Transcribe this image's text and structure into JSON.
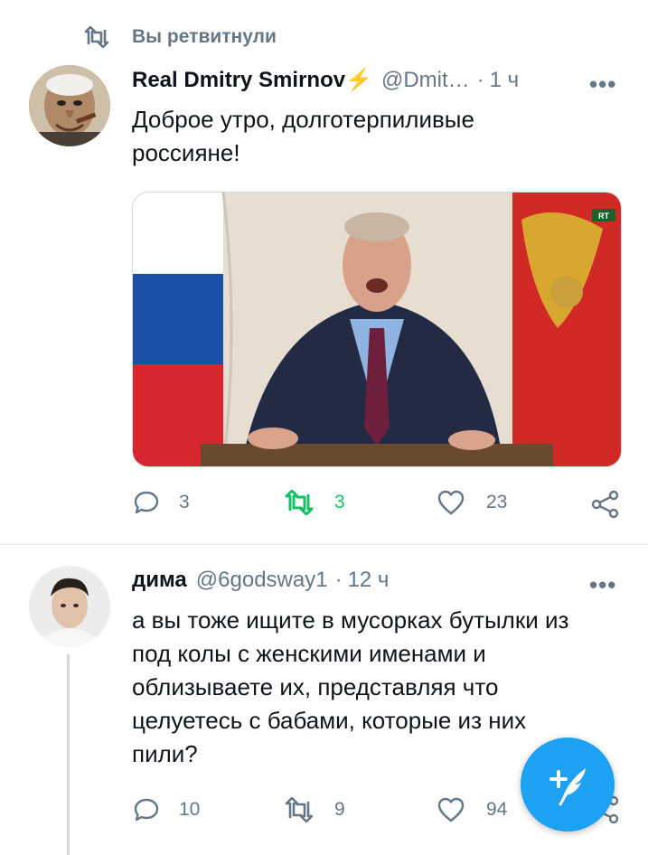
{
  "retweet_banner": {
    "label": "Вы ретвитнули"
  },
  "tweets": [
    {
      "author_name": "Real Dmitry Smirnov⚡",
      "handle": "@Dmit…",
      "separator": "·",
      "time": "1 ч",
      "text_lines": [
        "Доброе утро, долготерпиливые",
        "россияне!"
      ],
      "reply_count": "3",
      "retweet_count": "3",
      "like_count": "23",
      "media_badge": "RT",
      "retweeted": true
    },
    {
      "author_name": "дима",
      "handle": "@6godsway1",
      "separator": "·",
      "time": "12 ч",
      "text_lines": [
        "а вы тоже ищите в мусорках бутылки из",
        "под колы с женскими именами и",
        "облизываете их, представляя что",
        "целуетесь с бабами, которые из них",
        "пили?"
      ],
      "reply_count": "10",
      "retweet_count": "9",
      "like_count": "94",
      "retweeted": false
    }
  ],
  "more_label": "•••",
  "colors": {
    "accent": "#1da1f2",
    "retweet_green": "#17bf63",
    "muted": "#657786",
    "divider": "#e1e8ed"
  },
  "icons": [
    "retweet-icon",
    "reply-icon",
    "like-icon",
    "share-icon",
    "compose-icon",
    "more-icon"
  ]
}
